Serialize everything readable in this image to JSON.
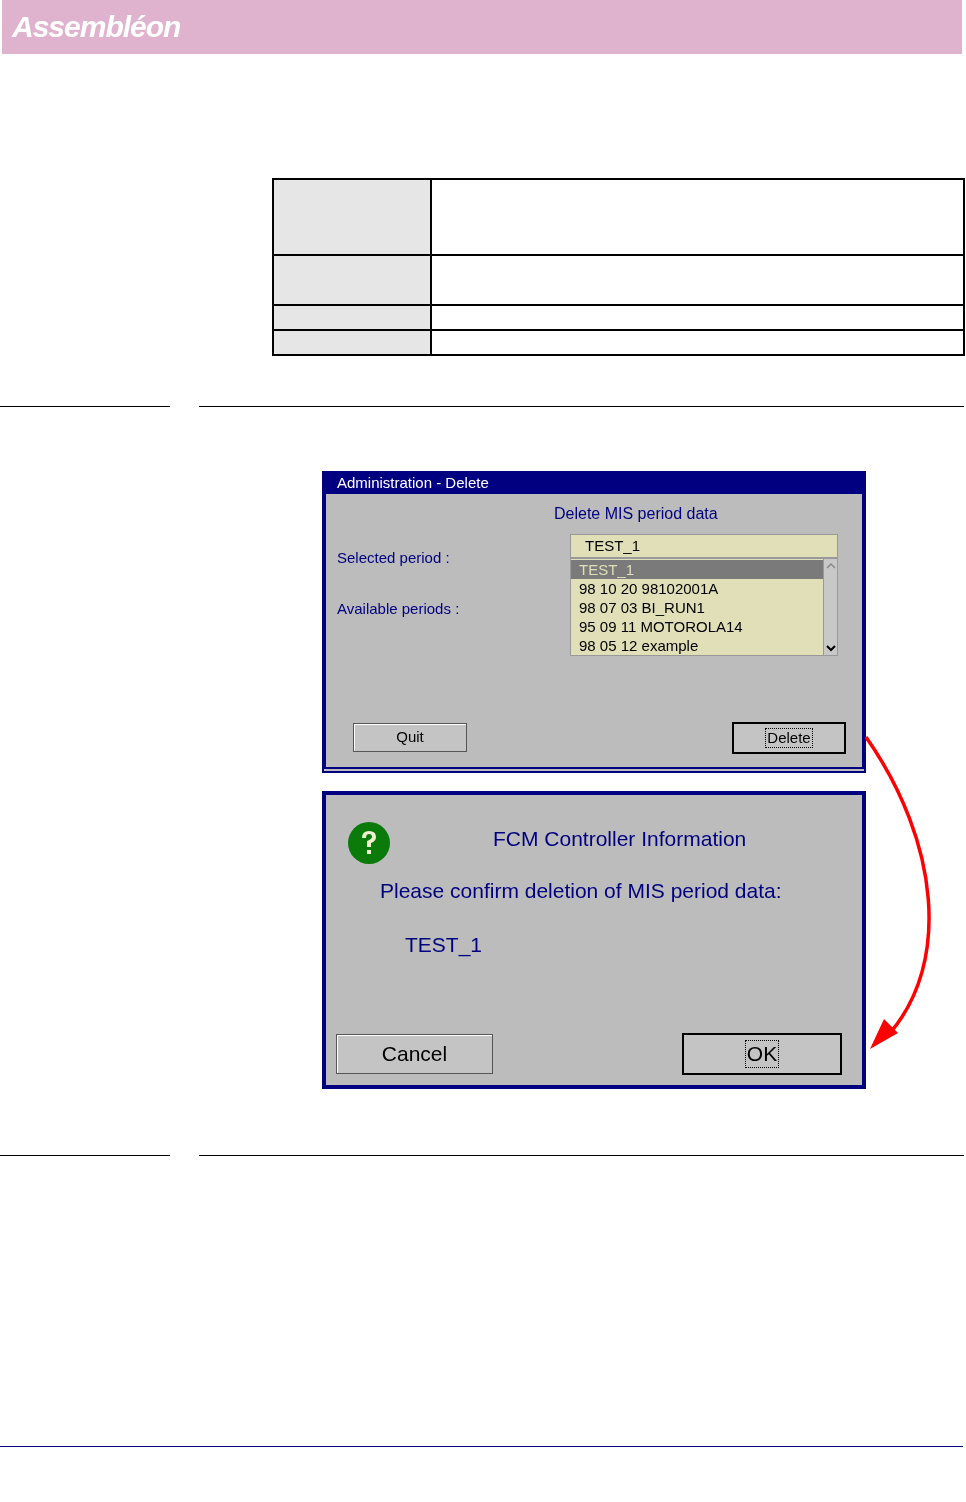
{
  "header": {
    "logo": "Assembléon"
  },
  "delete_dialog": {
    "title": "Administration - Delete",
    "heading": "Delete MIS period data",
    "selected_label": "Selected period :",
    "selected_value": "TEST_1",
    "available_label": "Available periods :",
    "periods": [
      {
        "label": "TEST_1",
        "selected": true
      },
      {
        "label": "98 10 20 98102001A",
        "selected": false
      },
      {
        "label": "98 07 03 BI_RUN1",
        "selected": false
      },
      {
        "label": "95 09 11 MOTOROLA14",
        "selected": false
      },
      {
        "label": "98 05 12 example",
        "selected": false
      }
    ],
    "buttons": [
      {
        "label": "Quit",
        "focused": false
      },
      {
        "label": "Delete",
        "focused": true
      }
    ]
  },
  "confirm_dialog": {
    "title": "FCM Controller Information",
    "message": "Please confirm deletion of MIS period data:",
    "period": "TEST_1",
    "buttons": [
      {
        "label": "Cancel",
        "focused": false
      },
      {
        "label": "OK",
        "focused": true
      }
    ]
  }
}
